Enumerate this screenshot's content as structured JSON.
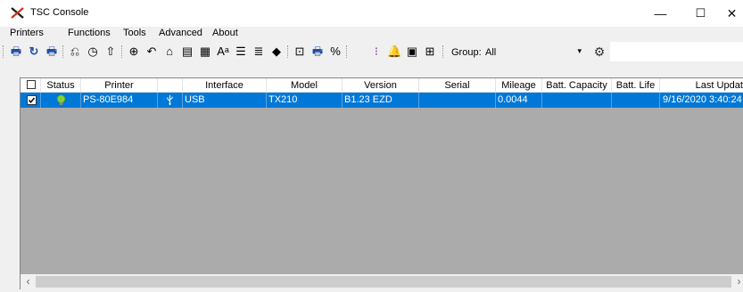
{
  "window": {
    "title": "TSC Console",
    "minimize": "—",
    "maximize": "☐",
    "close": "✕"
  },
  "menu": [
    "Printers",
    "Functions",
    "Tools",
    "Advanced",
    "About"
  ],
  "toolbar": {
    "group_label": "Group:",
    "group_value": "All"
  },
  "table": {
    "columns": [
      "",
      "Status",
      "Printer",
      "",
      "Interface",
      "Model",
      "Version",
      "Serial",
      "Mileage",
      "Batt. Capacity",
      "Batt. Life",
      "Last Update"
    ],
    "rows": [
      {
        "checked": true,
        "status": "online",
        "printer": "PS-80E984",
        "interface_icon": "usb-icon",
        "interface": "USB",
        "model": "TX210",
        "version": "B1.23 EZD",
        "serial": "",
        "mileage": "0.0044",
        "batt_capacity": "",
        "batt_life": "",
        "last_update": "9/16/2020 3:40:24"
      }
    ]
  },
  "colors": {
    "selection": "#0078d7",
    "grid_background": "#ababab",
    "status_online": "#7fd13b"
  }
}
